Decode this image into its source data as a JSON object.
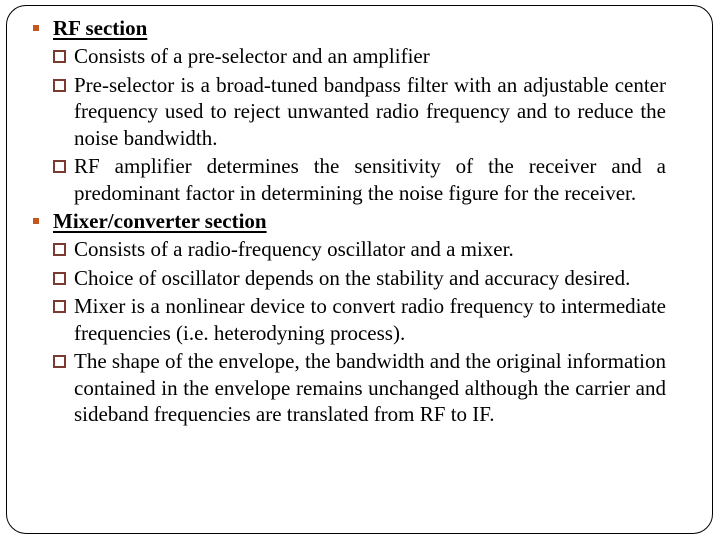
{
  "slide": {
    "sections": [
      {
        "title": "RF section",
        "items": [
          "Consists of a pre-selector and an amplifier",
          "Pre-selector is a broad-tuned bandpass filter with an adjustable center frequency used to reject unwanted radio frequency and to reduce the noise bandwidth.",
          "RF amplifier determines the sensitivity of the receiver and a predominant factor in determining the noise figure for the receiver."
        ]
      },
      {
        "title": "Mixer/converter section",
        "items": [
          "Consists of a radio-frequency oscillator and a mixer.",
          "Choice of oscillator depends on the stability and accuracy desired.",
          "Mixer is a nonlinear device to convert radio frequency to intermediate frequencies (i.e. heterodyning process).",
          "The shape of the envelope, the bandwidth and the original information contained in the envelope remains unchanged although the carrier and sideband frequencies are translated from RF to IF."
        ]
      }
    ],
    "colors": {
      "section_bullet": "#C4561F",
      "item_bullet": "#7A3A30",
      "frame_border": "#000000",
      "text": "#000000",
      "background": "#FFFFFF"
    }
  }
}
